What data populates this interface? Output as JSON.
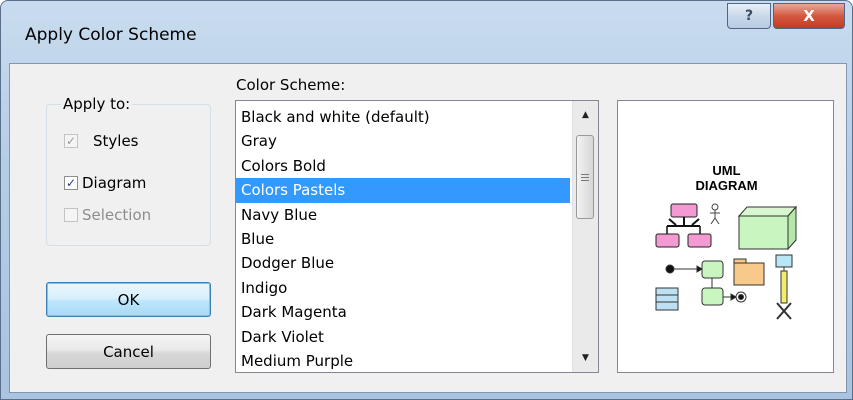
{
  "window": {
    "title": "Apply Color Scheme",
    "help_button": "?",
    "close_button": "X"
  },
  "apply_to": {
    "group_label": "Apply to:",
    "options": [
      {
        "label": "Styles",
        "checked": true,
        "enabled": false
      },
      {
        "label": "Diagram",
        "checked": true,
        "enabled": true
      },
      {
        "label": "Selection",
        "checked": false,
        "enabled": false
      }
    ]
  },
  "buttons": {
    "ok": "OK",
    "cancel": "Cancel"
  },
  "scheme": {
    "label": "Color Scheme:",
    "selected": "Colors Pastels",
    "items": [
      "Black and white (default)",
      "Gray",
      "Colors Bold",
      "Colors Pastels",
      "Navy Blue",
      "Blue",
      "Dodger Blue",
      "Indigo",
      "Dark Magenta",
      "Dark Violet",
      "Medium Purple"
    ]
  },
  "preview": {
    "title_line1": "UML",
    "title_line2": "DIAGRAM",
    "colors": {
      "class_pink": "#f39ad3",
      "node_green": "#c9f5c0",
      "folder_orange": "#f7c98a",
      "table_blue": "#bde1f2",
      "lifeline_yellow": "#f1ed6a",
      "lifeline_head": "#b9e6f5"
    }
  },
  "colors": {
    "selection": "#3399ff",
    "default_button_border": "#3c7fb1",
    "close_button": "#c43b21"
  }
}
